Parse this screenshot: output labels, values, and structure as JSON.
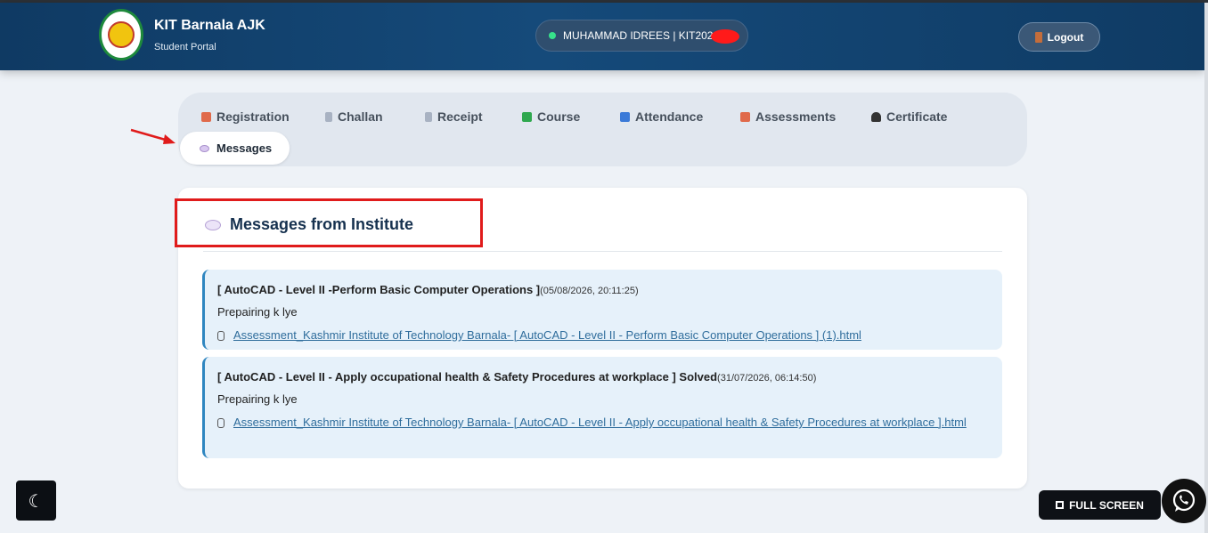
{
  "header": {
    "title": "KIT Barnala AJK",
    "subtitle": "Student Portal",
    "user": "MUHAMMAD IDREES | KIT202",
    "logout_label": "Logout"
  },
  "nav": {
    "items": [
      {
        "label": "Registration",
        "icon": "pencil-note-icon",
        "color": "#e06a4b"
      },
      {
        "label": "Challan",
        "icon": "document-icon",
        "color": "#a8b2c2"
      },
      {
        "label": "Receipt",
        "icon": "receipt-icon",
        "color": "#a8b2c2"
      },
      {
        "label": "Course",
        "icon": "books-icon",
        "color": "#2fa84f"
      },
      {
        "label": "Attendance",
        "icon": "calendar-icon",
        "color": "#3b7ad8"
      },
      {
        "label": "Assessments",
        "icon": "memo-icon",
        "color": "#e06a4b"
      },
      {
        "label": "Certificate",
        "icon": "graduation-cap-icon",
        "color": "#333333"
      }
    ],
    "active": "Messages"
  },
  "main": {
    "title": "Messages from Institute",
    "messages": [
      {
        "subject": "[ AutoCAD - Level II -Perform Basic Computer Operations ]",
        "date": "(05/08/2026, 20:11:25)",
        "body": "Prepairing k lye",
        "attachment": "Assessment_Kashmir Institute of Technology Barnala- [ AutoCAD - Level II - Perform Basic Computer Operations ] (1).html"
      },
      {
        "subject": "[ AutoCAD - Level II - Apply occupational health & Safety Procedures at workplace ] Solved",
        "date": "(31/07/2026, 06:14:50)",
        "body": "Prepairing k lye",
        "attachment": "Assessment_Kashmir Institute of Technology Barnala- [ AutoCAD - Level II - Apply occupational health & Safety Procedures at workplace ].html"
      }
    ]
  },
  "footer": {
    "fullscreen_label": "FULL SCREEN"
  },
  "colors": {
    "header_bg": "#0f3a63",
    "accent": "#2f86c0",
    "annotation_red": "#e01b1b"
  }
}
